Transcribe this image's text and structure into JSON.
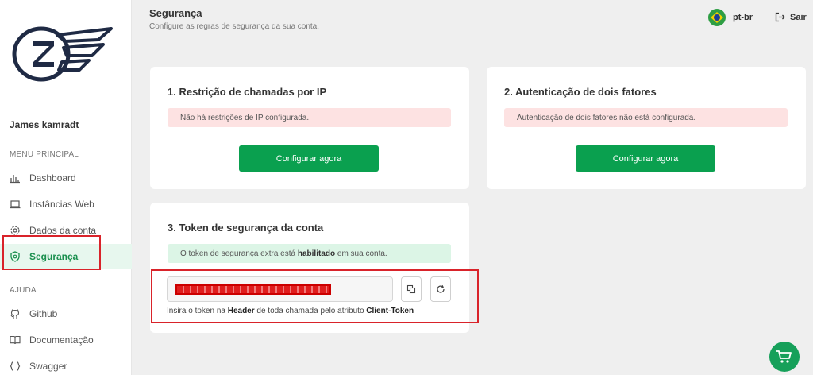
{
  "header": {
    "title": "Segurança",
    "subtitle": "Configure as regras de segurança da sua conta.",
    "language": "pt-br",
    "logout_label": "Sair"
  },
  "sidebar": {
    "user_name": "James kamradt",
    "menu_title": "MENU PRINCIPAL",
    "menu_items": [
      {
        "label": "Dashboard",
        "icon": "bar-chart-icon"
      },
      {
        "label": "Instâncias Web",
        "icon": "laptop-icon"
      },
      {
        "label": "Dados da conta",
        "icon": "gear-icon"
      },
      {
        "label": "Segurança",
        "icon": "shield-icon",
        "active": true
      }
    ],
    "help_title": "AJUDA",
    "help_items": [
      {
        "label": "Github",
        "icon": "github-icon"
      },
      {
        "label": "Documentação",
        "icon": "book-icon"
      },
      {
        "label": "Swagger",
        "icon": "swagger-icon"
      }
    ]
  },
  "cards": {
    "ip": {
      "title": "1. Restrição de chamadas por IP",
      "alert": "Não há restrições de IP configurada.",
      "button": "Configurar agora"
    },
    "twofa": {
      "title": "2. Autenticação de dois fatores",
      "alert": "Autenticação de dois fatores não está configurada.",
      "button": "Configurar agora"
    },
    "token": {
      "title": "3. Token de segurança da conta",
      "alert_prefix": "O token de segurança extra está ",
      "alert_status": "habilitado",
      "alert_suffix": " em sua conta.",
      "hint_prefix": "Insira o token na ",
      "hint_header": "Header",
      "hint_middle": " de toda chamada pelo atributo ",
      "hint_attr": "Client-Token"
    }
  },
  "colors": {
    "accent": "#0aa04f",
    "danger_bg": "#fde2e2",
    "success_bg": "#dcf5e6",
    "annotation": "#d9232a"
  }
}
